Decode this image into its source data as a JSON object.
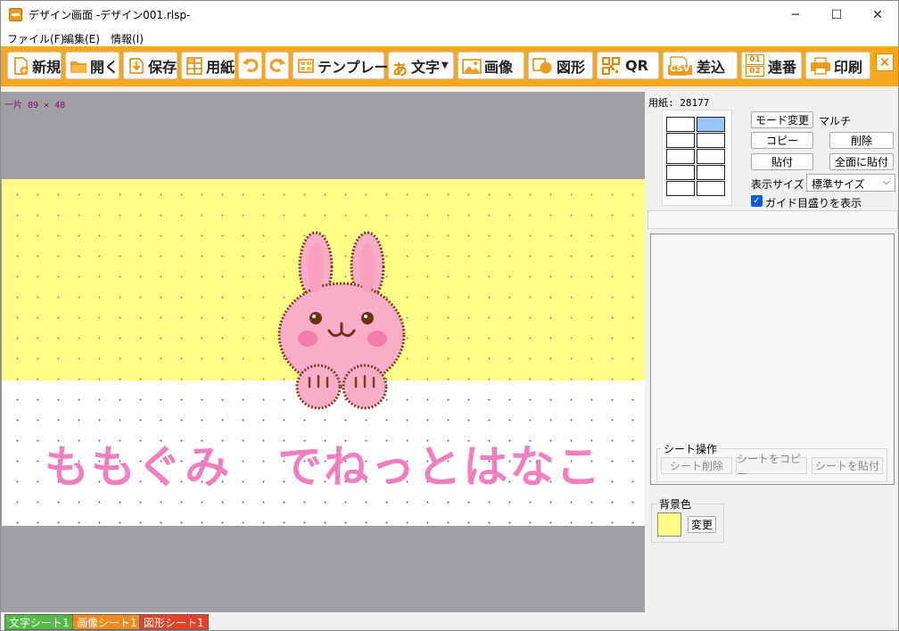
{
  "window": {
    "title": "デザイン画面 -デザイン001.rlsp-",
    "minimize": "─",
    "maximize": "☐",
    "close": "✕"
  },
  "menu": [
    "ファイル(F)",
    "編集(E)",
    "情報(I)"
  ],
  "toolbar": {
    "new": "新規",
    "open": "開く",
    "save": "保存",
    "paper": "用紙",
    "template": "テンプレート",
    "text": "文字",
    "text_icon": "あ",
    "image": "画像",
    "shape": "図形",
    "qr": "QR",
    "insert": "差込",
    "csv_icon": "CSV",
    "serial": "連番",
    "serial_icon_top": "01",
    "serial_icon_bottom": "02",
    "print": "印刷",
    "close": "✕"
  },
  "canvas": {
    "coords": "一片 89   × 48",
    "main_text": "ももぐみ　でねっとはなこ",
    "band_color": "#fffe86",
    "text_color": "#f17fc0"
  },
  "panel": {
    "paper_label": "用紙: 28177",
    "mode_change": "モード変更",
    "mode_value": "マルチ",
    "copy": "コピー",
    "delete": "削除",
    "paste": "貼付",
    "paste_all": "全面に貼付",
    "display_size_label": "表示サイズ",
    "display_size_value": "標準サイズ",
    "guide_label": "ガイド目盛りを表示",
    "guide_checked": true,
    "sheet_ops_label": "シート操作",
    "sheet_delete": "シート削除",
    "sheet_copy": "シートをコピー",
    "sheet_paste": "シートを貼付",
    "bg_label": "背景色",
    "bg_change": "変更",
    "bg_color": "#fffe86"
  },
  "bottom_tabs": [
    {
      "label": "文字シート1",
      "color": "#57b947"
    },
    {
      "label": "画像シート1",
      "color": "#f08a1c"
    },
    {
      "label": "図形シート1",
      "color": "#e6402b"
    }
  ]
}
